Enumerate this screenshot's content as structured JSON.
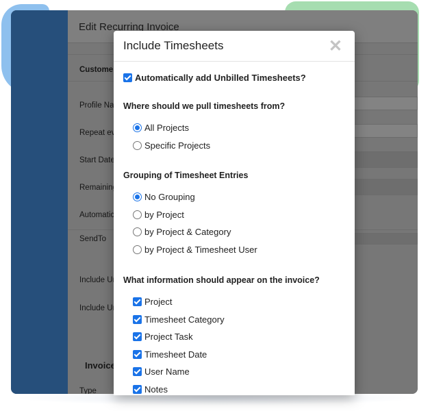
{
  "background_app": {
    "page_title": "Edit Recurring Invoice",
    "section_label": "Customer",
    "fields": [
      "Profile Na",
      "Repeat ev",
      "Start Date",
      "Remaining",
      "Automatic",
      "SendTo",
      "Include Ur",
      "Include Ur"
    ],
    "subheading": "Invoice",
    "footer_label": "Type"
  },
  "modal": {
    "title": "Include Timesheets",
    "close_glyph": "✕",
    "auto_add_label": "Automatically add Unbilled Timesheets?",
    "source_question": "Where should we pull timesheets from?",
    "source_options": [
      {
        "label": "All Projects",
        "selected": true
      },
      {
        "label": "Specific Projects",
        "selected": false
      }
    ],
    "grouping_question": "Grouping of Timesheet Entries",
    "grouping_options": [
      {
        "label": "No Grouping",
        "selected": true
      },
      {
        "label": "by Project",
        "selected": false
      },
      {
        "label": "by Project & Category",
        "selected": false
      },
      {
        "label": "by Project & Timesheet User",
        "selected": false
      }
    ],
    "info_question": "What information should appear on the invoice?",
    "info_options": [
      {
        "label": "Project",
        "checked": true
      },
      {
        "label": "Timesheet Category",
        "checked": true
      },
      {
        "label": "Project Task",
        "checked": true
      },
      {
        "label": "Timesheet Date",
        "checked": true
      },
      {
        "label": "User Name",
        "checked": true
      },
      {
        "label": "Notes",
        "checked": true
      }
    ]
  },
  "colors": {
    "sidebar": "#264f7b",
    "accent": "#1a73e8"
  }
}
